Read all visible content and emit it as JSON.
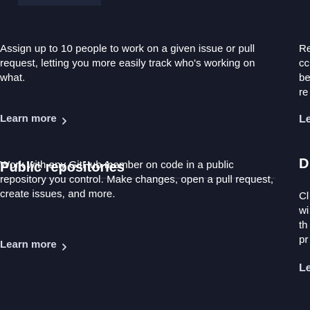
{
  "section1": {
    "description": "Assign up to 10 people to work on a given issue or pull request, letting you more easily track who's working on what.",
    "learn_more": "Learn more"
  },
  "section2": {
    "title": "Public repositories",
    "description": "Work with any GitHub member on code in a public repository you control. Make changes, open a pull request, create issues, and more.",
    "learn_more": "Learn more"
  },
  "right_column": {
    "lines": [
      "Re",
      "cc",
      "be",
      "re",
      "Le",
      "D",
      "Cl",
      "wi",
      "th",
      "pr",
      "Le"
    ]
  }
}
